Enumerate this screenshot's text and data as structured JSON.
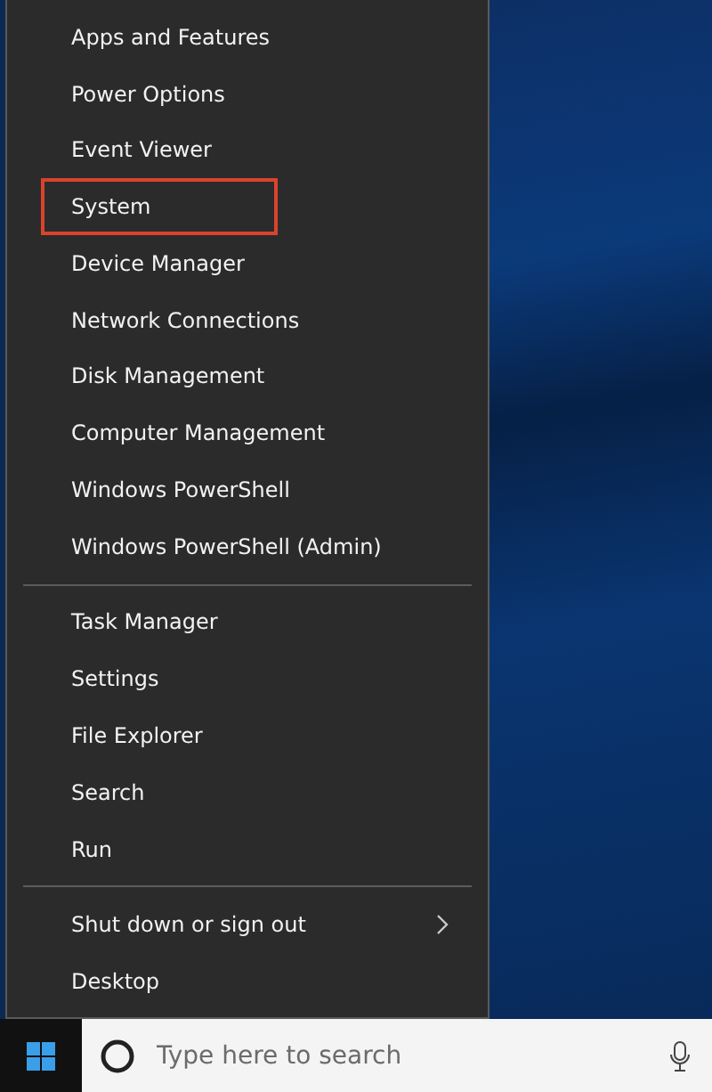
{
  "menu": {
    "sections": [
      {
        "items": [
          {
            "label": "Apps and Features",
            "highlighted": false,
            "submenu": false
          },
          {
            "label": "Power Options",
            "highlighted": false,
            "submenu": false
          },
          {
            "label": "Event Viewer",
            "highlighted": false,
            "submenu": false
          },
          {
            "label": "System",
            "highlighted": true,
            "submenu": false
          },
          {
            "label": "Device Manager",
            "highlighted": false,
            "submenu": false
          },
          {
            "label": "Network Connections",
            "highlighted": false,
            "submenu": false
          },
          {
            "label": "Disk Management",
            "highlighted": false,
            "submenu": false
          },
          {
            "label": "Computer Management",
            "highlighted": false,
            "submenu": false
          },
          {
            "label": "Windows PowerShell",
            "highlighted": false,
            "submenu": false
          },
          {
            "label": "Windows PowerShell (Admin)",
            "highlighted": false,
            "submenu": false
          }
        ]
      },
      {
        "items": [
          {
            "label": "Task Manager",
            "highlighted": false,
            "submenu": false
          },
          {
            "label": "Settings",
            "highlighted": false,
            "submenu": false
          },
          {
            "label": "File Explorer",
            "highlighted": false,
            "submenu": false
          },
          {
            "label": "Search",
            "highlighted": false,
            "submenu": false
          },
          {
            "label": "Run",
            "highlighted": false,
            "submenu": false
          }
        ]
      },
      {
        "items": [
          {
            "label": "Shut down or sign out",
            "highlighted": false,
            "submenu": true
          },
          {
            "label": "Desktop",
            "highlighted": false,
            "submenu": false
          }
        ]
      }
    ]
  },
  "taskbar": {
    "search": {
      "placeholder": "Type here to search"
    }
  }
}
